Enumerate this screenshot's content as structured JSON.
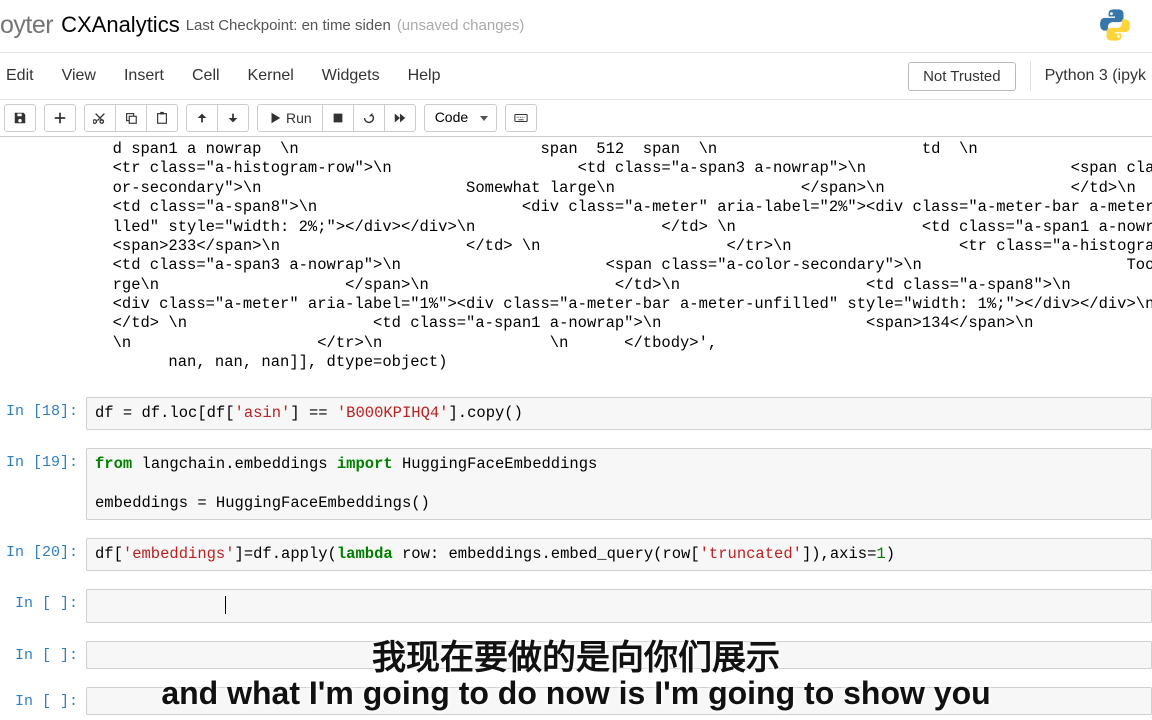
{
  "header": {
    "logo": "oyter",
    "notebook_name": "CXAnalytics",
    "checkpoint": "Last Checkpoint: en time siden",
    "unsaved": "(unsaved changes)"
  },
  "menubar": {
    "items": [
      "Edit",
      "View",
      "Insert",
      "Cell",
      "Kernel",
      "Widgets",
      "Help"
    ],
    "trust": "Not Trusted",
    "kernel": "Python 3 (ipyk"
  },
  "toolbar": {
    "run_label": "Run",
    "celltype": "Code"
  },
  "output_text": "  d span1 a nowrap  \\n                          span  512  span  \\n                      td  \\n                    \\n\n  <tr class=\"a-histogram-row\">\\n                    <td class=\"a-span3 a-nowrap\">\\n                      <span class=\"a-\n  or-secondary\">\\n                      Somewhat large\\n                    </span>\\n                    </td>\\n\n  <td class=\"a-span8\">\\n                      <div class=\"a-meter\" aria-label=\"2%\"><div class=\"a-meter-bar a-meter-u\n  lled\" style=\"width: 2%;\"></div></div>\\n                    </td> \\n                    <td class=\"a-span1 a-nowrap\">\\n\n  <span>233</span>\\n                    </td> \\n                    </tr>\\n                  <tr class=\"a-histogram-row\">\\n\n  <td class=\"a-span3 a-nowrap\">\\n                      <span class=\"a-color-secondary\">\\n                      Too\n  rge\\n                    </span>\\n                    </td>\\n                    <td class=\"a-span8\">\\n\n  <div class=\"a-meter\" aria-label=\"1%\"><div class=\"a-meter-bar a-meter-unfilled\" style=\"width: 1%;\"></div></div>\\n\n  </td> \\n                    <td class=\"a-span1 a-nowrap\">\\n                      <span>134</span>\\n                    </t\n  \\n                    </tr>\\n                  \\n      </tbody>',\n        nan, nan, nan]], dtype=object)",
  "cells": [
    {
      "prompt": "In [18]:",
      "code_html": "df = df.loc[df[<span class='str-red'>'asin'</span>] == <span class='str-red'>'B000KPIHQ4'</span>].copy()"
    },
    {
      "prompt": "In [19]:",
      "code_html": "<span class='kw-green'>from</span> langchain.embeddings <span class='kw-import'>import</span> HuggingFaceEmbeddings\n\nembeddings = HuggingFaceEmbeddings()"
    },
    {
      "prompt": "In [20]:",
      "code_html": "df[<span class='str-red'>'embeddings'</span>]=df.apply(<span class='kw-green'>lambda</span> row: embeddings.embed_query(row[<span class='str-red'>'truncated'</span>]),axis=<span class='num-green'>1</span>)"
    },
    {
      "prompt": "In [ ]:",
      "code_html": ""
    },
    {
      "prompt": "In [ ]:",
      "code_html": ""
    },
    {
      "prompt": "In [ ]:",
      "code_html": ""
    }
  ],
  "subtitles": {
    "cn": "我现在要做的是向你们展示",
    "en": "and what I'm going to do now is I'm going to show you"
  }
}
